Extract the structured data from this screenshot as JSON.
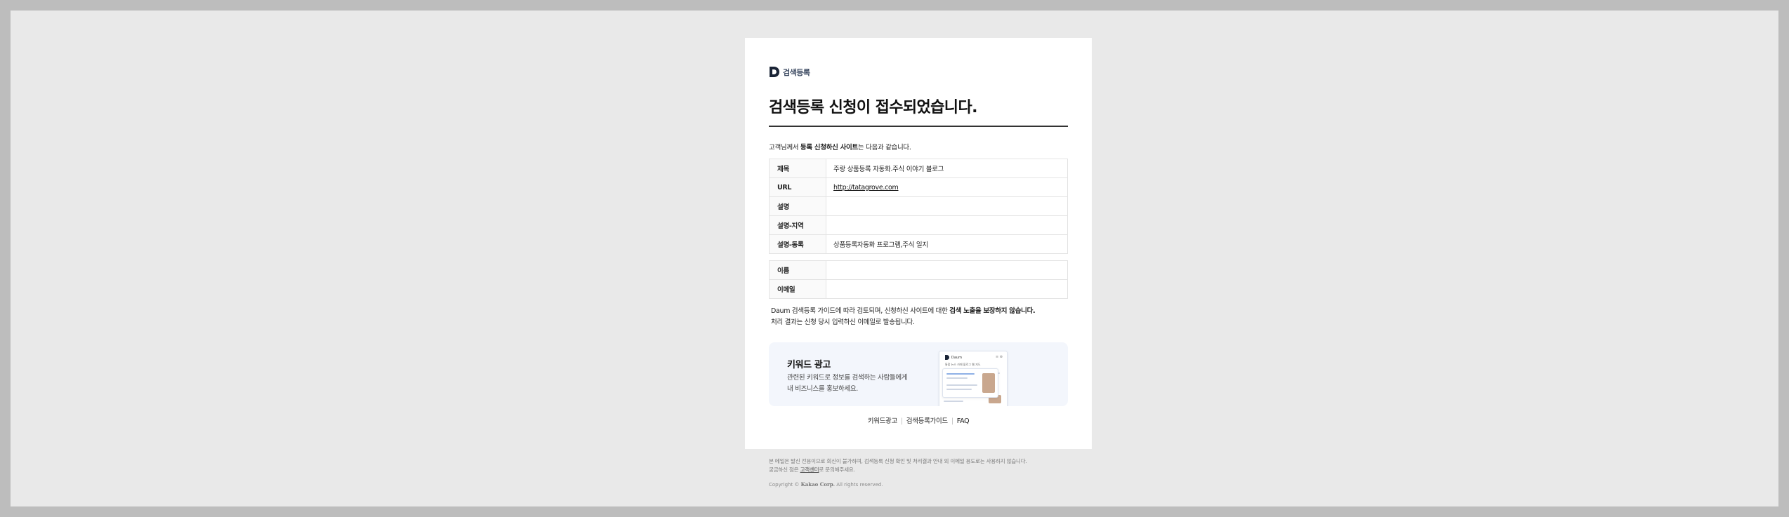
{
  "header": {
    "logo_icon": "daum-d-logo-icon",
    "logo_text": "검색등록",
    "title": "검색등록 신청이 접수되었습니다."
  },
  "intro": {
    "prefix": "고객님께서 ",
    "bold": "등록 신청하신 사이트",
    "suffix": "는 다음과 같습니다."
  },
  "site_info": {
    "rows": [
      {
        "label": "제목",
        "value": "주랑 상품등록 자동화.주식 이야기 블로그"
      },
      {
        "label": "URL",
        "value": "http://tatagrove.com"
      },
      {
        "label": "설명",
        "value": ""
      },
      {
        "label": "설명-지역",
        "value": ""
      },
      {
        "label": "설명-동록",
        "value": "상품등록자동화 프로그램,주식 일지"
      }
    ]
  },
  "applicant_info": {
    "rows": [
      {
        "label": "이름",
        "value": ""
      },
      {
        "label": "이메일",
        "value": ""
      }
    ]
  },
  "notice": {
    "line1_pre": "Daum 검색등록 가이드에 따라 검토되며, 신청하신 사이트에 대한 ",
    "line1_bold": "검색 노출을 보장하지 않습니다.",
    "line2": "처리 결과는 신청 당시 입력하신 이메일로 발송됩니다."
  },
  "banner": {
    "title": "키워드 광고",
    "desc_line1": "관련된 키워드로 정보를 검색하는 사람들에게",
    "desc_line2": "내 비즈니스를 홍보하세요.",
    "mock_brand": "Daum",
    "mock_ctrl": "≡ ⊕",
    "mock_tabs": "통합  뉴스  카페  블로그  웹  지도"
  },
  "footer_links": [
    {
      "label": "키워드광고"
    },
    {
      "label": "검색등록가이드"
    },
    {
      "label": "FAQ"
    }
  ],
  "fine_print": {
    "line1": "본 메일은 발신 전용이므로 회신이 불가하며, 검색등록 신청 확인 및 처리결과 안내 외 이메일 용도로는 사용하지 않습니다.",
    "line2_pre": "궁금하신 점은 ",
    "line2_link": "고객센터",
    "line2_post": "로 문의해주세요.",
    "copyright_pre": "Copyright © ",
    "copyright_brand": "Kakao Corp.",
    "copyright_post": " All rights reserved."
  },
  "colors": {
    "page_bg": "#e9e9e9",
    "outer_bg": "#bdbdbd",
    "card_bg": "#ffffff",
    "banner_bg": "#f3f6fc",
    "logo_color": "#1a2436"
  }
}
